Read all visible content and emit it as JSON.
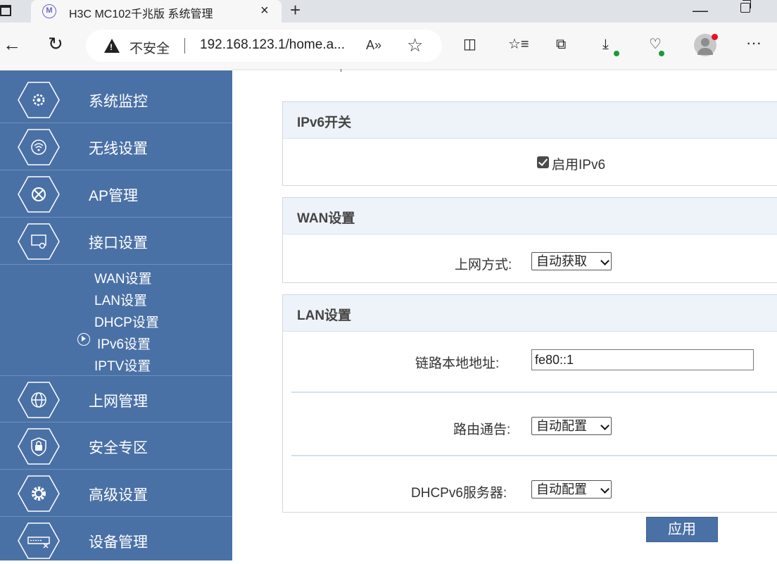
{
  "browser": {
    "tab_title": "H3C MC102千兆版 系统管理",
    "tab_close": "×",
    "new_tab": "+",
    "insecure_label": "不安全",
    "url": "192.168.123.1/home.a...",
    "read_aloud": "A»",
    "more": "···"
  },
  "sidebar": {
    "items": [
      {
        "label": "系统监控",
        "icon": "monitor-gear-icon"
      },
      {
        "label": "无线设置",
        "icon": "wifi-icon"
      },
      {
        "label": "AP管理",
        "icon": "ap-icon"
      },
      {
        "label": "接口设置",
        "icon": "interface-icon"
      },
      {
        "label": "上网管理",
        "icon": "globe-icon"
      },
      {
        "label": "安全专区",
        "icon": "lock-icon"
      },
      {
        "label": "高级设置",
        "icon": "gear-icon"
      },
      {
        "label": "设备管理",
        "icon": "device-icon"
      }
    ],
    "subitems": [
      "WAN设置",
      "LAN设置",
      "DHCP设置",
      "IPv6设置",
      "IPTV设置"
    ],
    "active_subitem": "IPv6设置"
  },
  "ipv6_switch": {
    "title": "IPv6开关",
    "enable_label": "启用IPv6",
    "enabled": true
  },
  "wan": {
    "title": "WAN设置",
    "mode_label": "上网方式:",
    "mode_value": "自动获取"
  },
  "lan": {
    "title": "LAN设置",
    "link_local_label": "链路本地地址:",
    "link_local_value": "fe80::1",
    "router_adv_label": "路由通告:",
    "router_adv_value": "自动配置",
    "dhcpv6_label": "DHCPv6服务器:",
    "dhcpv6_value": "自动配置"
  },
  "apply_label": "应用"
}
